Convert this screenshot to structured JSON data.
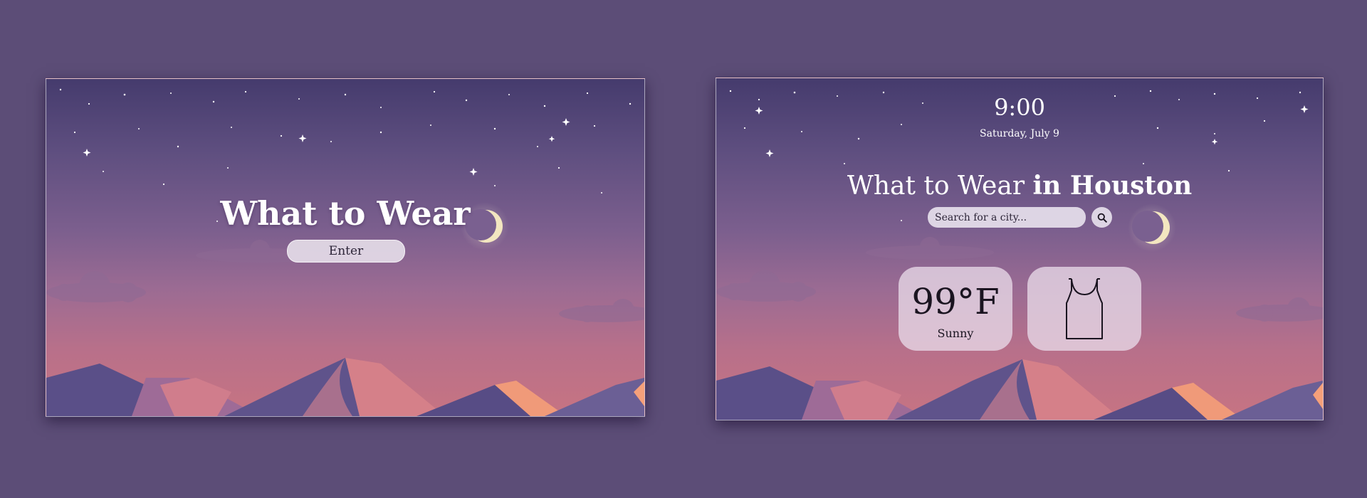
{
  "landing": {
    "title": "What to Wear",
    "enter_label": "Enter"
  },
  "dashboard": {
    "time": "9:00",
    "date": "Saturday, July 9",
    "title_prefix": "What to Wear",
    "title_city": "in Houston",
    "search": {
      "placeholder": "Search for a city...",
      "value": ""
    },
    "weather": {
      "temperature": "99°F",
      "condition": "Sunny"
    },
    "outfit_icon": "tank-top-icon"
  },
  "colors": {
    "background": "#5c4d77",
    "sky_top": "#453b6d",
    "sky_bottom": "#c77482",
    "moon": "#f3e6c0",
    "card": "#e8dae8"
  }
}
